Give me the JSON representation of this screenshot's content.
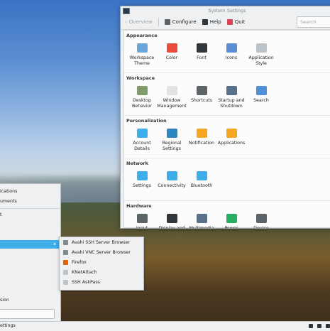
{
  "window": {
    "title": "System Settings",
    "toolbar": {
      "overview": "Overview",
      "configure": "Configure",
      "help": "Help",
      "quit": "Quit"
    },
    "search_placeholder": "Search",
    "sections": [
      {
        "title": "Appearance",
        "items": [
          {
            "label": "Workspace\nTheme",
            "icon": "workspace-theme-icon",
            "color": "#6aa7d8"
          },
          {
            "label": "Color",
            "icon": "color-icon",
            "color": "#e74c3c"
          },
          {
            "label": "Font",
            "icon": "font-icon",
            "color": "#31363b"
          },
          {
            "label": "Icons",
            "icon": "icons-icon",
            "color": "#5c8ed6"
          },
          {
            "label": "Application\nStyle",
            "icon": "application-style-icon",
            "color": "#bdc3c7"
          }
        ]
      },
      {
        "title": "Workspace",
        "items": [
          {
            "label": "Desktop\nBehavior",
            "icon": "desktop-behavior-icon",
            "color": "#7f9c6a"
          },
          {
            "label": "Window\nManagement",
            "icon": "window-management-icon",
            "color": "#dfe3e6"
          },
          {
            "label": "Shortcuts",
            "icon": "shortcuts-icon",
            "color": "#5d6468"
          },
          {
            "label": "Startup and\nShutdown",
            "icon": "startup-shutdown-icon",
            "color": "#59708a"
          },
          {
            "label": "Search",
            "icon": "search-settings-icon",
            "color": "#4e8fd6"
          }
        ]
      },
      {
        "title": "Personalization",
        "items": [
          {
            "label": "Account\nDetails",
            "icon": "account-details-icon",
            "color": "#3daee9"
          },
          {
            "label": "Regional\nSettings",
            "icon": "regional-settings-icon",
            "color": "#2e86c1"
          },
          {
            "label": "Notification",
            "icon": "notification-icon",
            "color": "#f5a623"
          },
          {
            "label": "Applications",
            "icon": "applications-star-icon",
            "color": "#f5a623"
          }
        ]
      },
      {
        "title": "Network",
        "items": [
          {
            "label": "Settings",
            "icon": "network-settings-icon",
            "color": "#3daee9"
          },
          {
            "label": "Connectivity",
            "icon": "connectivity-icon",
            "color": "#3daee9"
          },
          {
            "label": "Bluetooth",
            "icon": "bluetooth-icon",
            "color": "#3daee9"
          }
        ]
      },
      {
        "title": "Hardware",
        "items": [
          {
            "label": "Input Devices",
            "icon": "input-devices-icon",
            "color": "#5d6468"
          },
          {
            "label": "Display and",
            "icon": "display-icon",
            "color": "#31363b"
          },
          {
            "label": "Multimedia",
            "icon": "multimedia-icon",
            "color": "#59708a"
          },
          {
            "label": "Power",
            "icon": "power-icon",
            "color": "#27ae60"
          },
          {
            "label": "Device",
            "icon": "device-icon",
            "color": "#5d6468"
          }
        ]
      }
    ]
  },
  "menu": {
    "items": [
      "ications",
      "uments",
      "",
      "t"
    ],
    "bottom_label": "sion"
  },
  "submenu": {
    "items": [
      {
        "label": "Avahi SSH Server Browser",
        "icon": "avahi-ssh-icon",
        "color": "#7f8c8d"
      },
      {
        "label": "Avahi VNC Server Browser",
        "icon": "avahi-vnc-icon",
        "color": "#7f8c8d"
      },
      {
        "label": "Firefox",
        "icon": "firefox-icon",
        "color": "#e66000"
      },
      {
        "label": "KNetAttach",
        "icon": "knetattach-icon",
        "color": "#bdc3c7"
      },
      {
        "label": "SSH AskPass",
        "icon": "ssh-askpass-icon",
        "color": "#bdc3c7"
      }
    ]
  },
  "panel": {
    "task_label": "ettings"
  }
}
